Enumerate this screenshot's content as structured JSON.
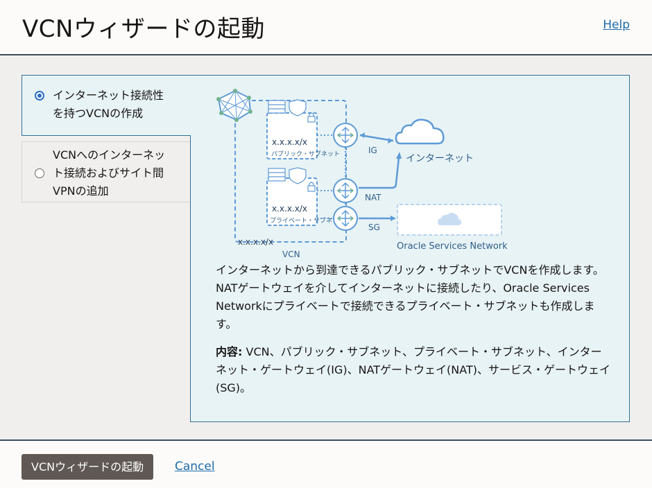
{
  "header": {
    "title": "VCNウィザードの起動",
    "help_label": "Help"
  },
  "options": [
    {
      "label_line1": "インターネット接続性",
      "label_line2": "を持つVCNの作成",
      "selected": true
    },
    {
      "label_line1": "VCNへのインターネッ",
      "label_line2": "ト接続およびサイト間",
      "label_line3": "VPNの追加",
      "selected": false
    }
  ],
  "diagram": {
    "subnet_cidr": "x.x.x.x/x",
    "public_subnet": "パブリック・サブネット",
    "private_subnet": "プライベート・サブネット",
    "vcn_cidr": "x.x.x.x/x",
    "vcn_label": "VCN",
    "ig_label": "IG",
    "nat_label": "NAT",
    "sg_label": "SG",
    "internet_label": "インターネット",
    "osn_label": "Oracle Services Network",
    "colors": {
      "accent": "#5d9ad6",
      "panel_bg": "#e8f3f6",
      "teal_dot": "#72b38c"
    }
  },
  "panel": {
    "description": "インターネットから到達できるパブリック・サブネットでVCNを作成します。NATゲートウェイを介してインターネットに接続したり、Oracle Services Networkにプライベートで接続できるプライベート・サブネットも作成します。",
    "contents_label": "内容:",
    "contents_text": " VCN、パブリック・サブネット、プライベート・サブネット、インターネット・ゲートウェイ(IG)、NATゲートウェイ(NAT)、サービス・ゲートウェイ(SG)。"
  },
  "footer": {
    "start_button": "VCNウィザードの起動",
    "cancel_label": "Cancel"
  }
}
